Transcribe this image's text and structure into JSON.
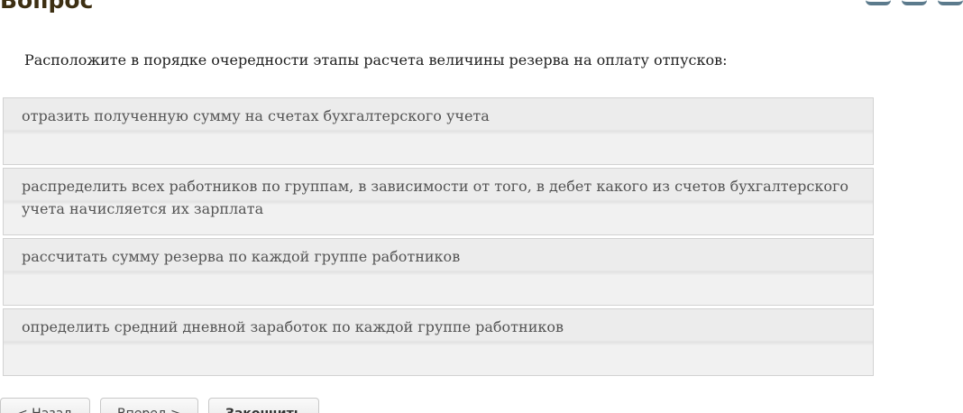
{
  "page": {
    "title": "Вопрос"
  },
  "question": {
    "text": "Расположите в порядке очередности этапы расчета величины резерва на оплату отпусков:"
  },
  "answers": [
    {
      "label": "отразить полученную сумму на счетах бухгалтерского учета"
    },
    {
      "label": "распределить всех работников по группам, в зависимости от того, в дебет какого из счетов бухгалтерского учета начисляется их зарплата"
    },
    {
      "label": "рассчитать сумму резерва по каждой группе работников"
    },
    {
      "label": "определить средний дневной заработок по каждой группе работников"
    }
  ],
  "nav": {
    "back_label": "< Назад",
    "forward_label": "Вперед >",
    "finish_label": "Закончить"
  },
  "colors": {
    "title": "#3d2f12",
    "answer_background": "#ececec",
    "answer_border": "#d2d2d2",
    "answer_text": "#545454"
  }
}
